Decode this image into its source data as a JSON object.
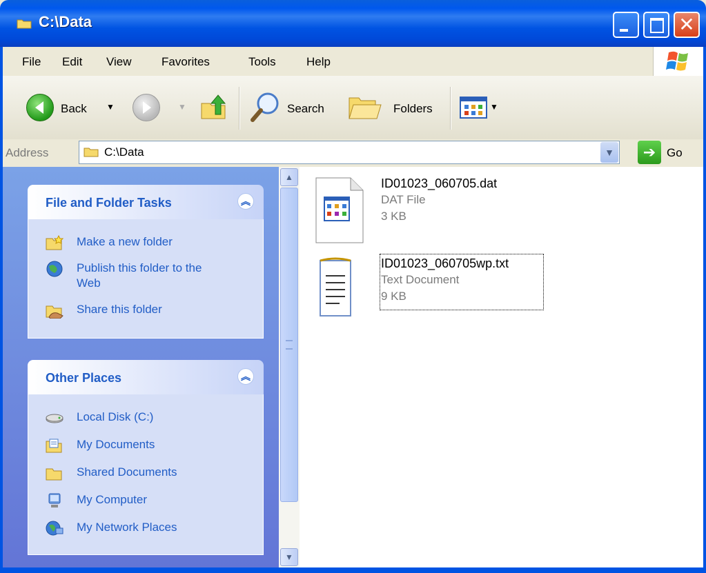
{
  "window": {
    "title": "C:\\Data"
  },
  "menubar": {
    "items": [
      "File",
      "Edit",
      "View",
      "Favorites",
      "Tools",
      "Help"
    ]
  },
  "toolbar": {
    "back_label": "Back",
    "search_label": "Search",
    "folders_label": "Folders"
  },
  "address": {
    "label": "Address",
    "value": "C:\\Data",
    "go_label": "Go"
  },
  "tasks_panel": {
    "title": "File and Folder Tasks",
    "items": [
      {
        "label": "Make a new folder",
        "icon": "new-folder-icon"
      },
      {
        "label": "Publish this folder to the Web",
        "icon": "publish-web-icon"
      },
      {
        "label": "Share this folder",
        "icon": "share-folder-icon"
      }
    ]
  },
  "places_panel": {
    "title": "Other Places",
    "items": [
      {
        "label": "Local Disk (C:)",
        "icon": "local-disk-icon"
      },
      {
        "label": "My Documents",
        "icon": "my-documents-icon"
      },
      {
        "label": "Shared Documents",
        "icon": "shared-documents-icon"
      },
      {
        "label": "My Computer",
        "icon": "my-computer-icon"
      },
      {
        "label": "My Network Places",
        "icon": "network-places-icon"
      }
    ]
  },
  "files": [
    {
      "name": "ID01023_060705.dat",
      "type": "DAT File",
      "size": "3 KB",
      "icon": "dat-file-icon"
    },
    {
      "name": "ID01023_060705wp.txt",
      "type": "Text Document",
      "size": "9 KB",
      "icon": "text-file-icon"
    }
  ],
  "colors": {
    "title_bar": "#0054e3",
    "task_link": "#215dc6",
    "pane_background": "#6f8ee0"
  }
}
